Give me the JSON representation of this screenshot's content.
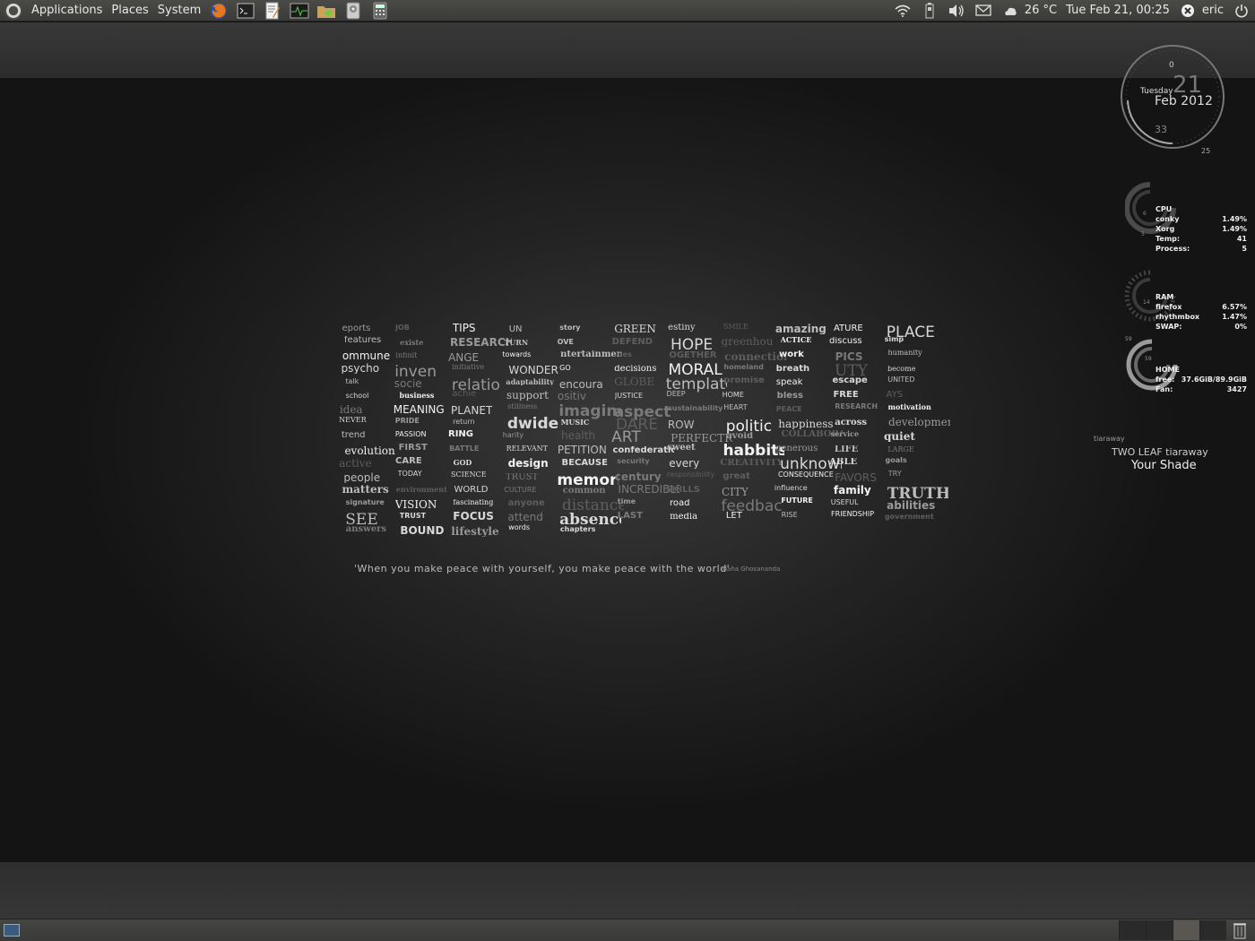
{
  "top_panel": {
    "menus": [
      "Applications",
      "Places",
      "System"
    ],
    "launchers": [
      "firefox-icon",
      "terminal-icon",
      "text-editor-icon",
      "system-monitor-icon",
      "file-manager-icon",
      "disk-utility-icon",
      "calculator-icon"
    ],
    "weather": "26 °C",
    "datetime": "Tue Feb 21, 00:25",
    "user": "eric"
  },
  "clock": {
    "weekday": "Tuesday",
    "day": "21",
    "month_year": "Feb 2012",
    "hour_mark": "0",
    "minute_mark": "33",
    "second_mark": "25"
  },
  "cpu": {
    "title": "CPU",
    "ring_labels": [
      "6",
      "5"
    ],
    "rows": [
      {
        "label": "conky",
        "value": "1.49%"
      },
      {
        "label": "Xorg",
        "value": "1.49%"
      },
      {
        "label": "Temp:",
        "value": "41"
      },
      {
        "label": "Process:",
        "value": "5"
      }
    ]
  },
  "ram": {
    "title": "RAM",
    "ring_labels": [
      "14"
    ],
    "rows": [
      {
        "label": "firefox",
        "value": "6.57%"
      },
      {
        "label": "rhythmbox",
        "value": "1.47%"
      },
      {
        "label": "SWAP:",
        "value": "0%"
      }
    ]
  },
  "home": {
    "title": "HOME",
    "ring_labels": [
      "59",
      "59"
    ],
    "rows": [
      {
        "label": "free:",
        "value": "37.6GiB/89.9GiB"
      },
      {
        "label": "Fan:",
        "value": "3427"
      }
    ]
  },
  "music": {
    "artist_small": "tiaraway",
    "line1": "TWO  LEAF tiaraway",
    "line2": "Your Shade"
  },
  "wallpaper": {
    "quote": "'When you make peace with yourself, you make peace with the world'",
    "author": "Maha Ghosananda",
    "words": [
      "eports",
      "JOB",
      "TIPS",
      "UN",
      "story",
      "GREEN",
      "estiny",
      "SMILE",
      "amazing",
      "ATURE",
      "PLACE",
      "features",
      "existe",
      "RESEARCH",
      "TURN",
      "OVE",
      "DEFEND",
      "HOPE",
      "greenhou",
      "ACTICE",
      "discuss",
      "simp",
      "ommune",
      "infinit",
      "ANGE",
      "towards",
      "ntertainment",
      "ues",
      "OGETHER",
      "connection",
      "work",
      "PICS",
      "humanity",
      "psycho",
      "inven",
      "initiative",
      "WONDER",
      "GO",
      "decisions",
      "MORAL",
      "homeland",
      "breath",
      "UTY",
      "become",
      "talk",
      "socie",
      "relatio",
      "adaptability",
      "encoura",
      "GLOBE",
      "template",
      "promise",
      "speak",
      "escape",
      "UNITED",
      "school",
      "business",
      "achie",
      "support",
      "ositiv",
      "JUSTICE",
      "DEEP",
      "HOME",
      "bless",
      "FREE",
      "AYS",
      "idea",
      "MEANING",
      "PLANET",
      "stillness",
      "imagine",
      "aspect",
      "sustainability",
      "HEART",
      "PEACE",
      "RESEARCH",
      "motivation",
      "NEVER",
      "PRIDE",
      "return",
      "dwide",
      "MUSIC",
      "DARE",
      "ROW",
      "politic",
      "happiness",
      "across",
      "development",
      "trend",
      "PASSION",
      "RING",
      "harity",
      "health",
      "ART",
      "PERFECTION",
      "avoid",
      "COLLABORATION",
      "service",
      "quiet",
      "evolution",
      "FIRST",
      "BATTLE",
      "RELEVANT",
      "PETITION",
      "confederation",
      "sweet",
      "habbits",
      "generous",
      "LIFE",
      "LARGE",
      "active",
      "CARE",
      "GOD",
      "design",
      "BECAUSE",
      "security",
      "every",
      "CREATIVITY",
      "unknown",
      "ABLE",
      "goals",
      "people",
      "TODAY",
      "SCIENCE",
      "TRUST",
      "memories",
      "century",
      "responsibility",
      "great",
      "CONSEQUENCE",
      "FAVORS",
      "TRY",
      "matters",
      "environment",
      "WORLD",
      "CULTURE",
      "common",
      "INCREDIBLE",
      "SKILLS",
      "CITY",
      "influence",
      "family",
      "TRUTH",
      "signature",
      "VISION",
      "fascinating",
      "anyone",
      "distance",
      "time",
      "road",
      "feedback",
      "FUTURE",
      "USEFUL",
      "abilities",
      "SEE",
      "TRUST",
      "FOCUS",
      "attend",
      "absence",
      "LAST",
      "media",
      "LET",
      "RISE",
      "FRIENDSHIP",
      "government",
      "answers",
      "BOUND",
      "lifestyle",
      "words",
      "chapters"
    ]
  }
}
